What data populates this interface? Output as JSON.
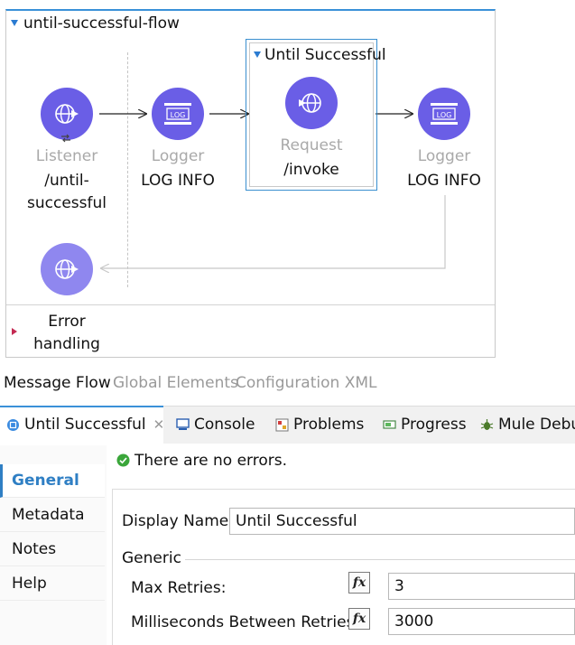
{
  "flow": {
    "title": "until-successful-flow",
    "listener": {
      "type": "Listener",
      "path": "/until-\nsuccessful",
      "icon": "http-listener-icon"
    },
    "logger1": {
      "type": "Logger",
      "label": "LOG INFO",
      "badge": "LOG"
    },
    "scope": {
      "title": "Until Successful"
    },
    "request": {
      "type": "Request",
      "path": "/invoke",
      "icon": "http-request-icon"
    },
    "logger2": {
      "type": "Logger",
      "label": "LOG INFO",
      "badge": "LOG"
    },
    "error_handling": "Error\nhandling"
  },
  "editor_tabs": [
    "Message Flow",
    "Global Elements",
    "Configuration XML"
  ],
  "panel_tabs": {
    "until": "Until Successful",
    "console": "Console",
    "problems": "Problems",
    "progress": "Progress",
    "mule_debug": "Mule Debug"
  },
  "sidebar": [
    "General",
    "Metadata",
    "Notes",
    "Help"
  ],
  "status": "There are no errors.",
  "form": {
    "display_name_label": "Display Name:",
    "display_name_value": "Until Successful",
    "group_label": "Generic",
    "max_retries_label": "Max Retries:",
    "max_retries_value": "3",
    "millis_label": "Milliseconds Between Retries:",
    "millis_value": "3000",
    "fx": "fx"
  },
  "colors": {
    "node": "#6a5ee6",
    "accent": "#3a91d8",
    "error_marker": "#c42a52"
  }
}
